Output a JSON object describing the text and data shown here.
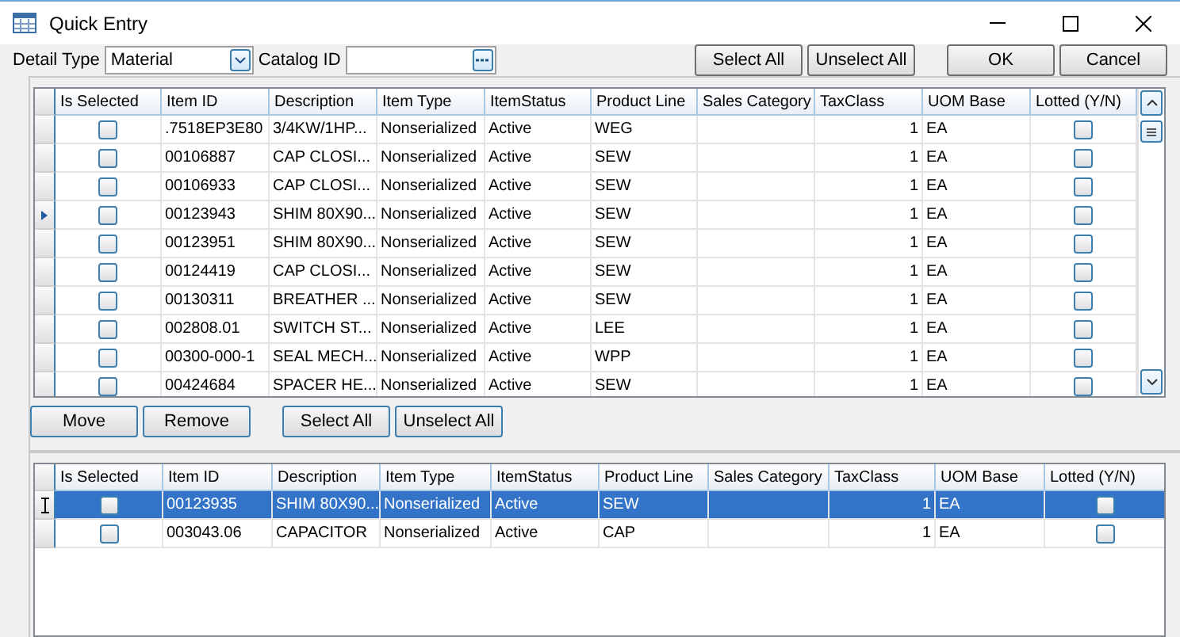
{
  "window": {
    "title": "Quick Entry"
  },
  "toolbar": {
    "detail_type_label": "Detail Type",
    "detail_type_value": "Material",
    "catalog_label": "Catalog ID",
    "buttons": [
      "Select All",
      "Unselect All",
      "OK",
      "Cancel"
    ]
  },
  "top_grid": {
    "columns": [
      {
        "label": "Is Selected",
        "kind": "check"
      },
      {
        "label": "Item ID",
        "kind": "text"
      },
      {
        "label": "Description",
        "kind": "text"
      },
      {
        "label": "Item Type",
        "kind": "text"
      },
      {
        "label": "ItemStatus",
        "kind": "text"
      },
      {
        "label": "Product Line",
        "kind": "text"
      },
      {
        "label": "Sales Category",
        "kind": "text"
      },
      {
        "label": "TaxClass",
        "kind": "number"
      },
      {
        "label": "UOM Base",
        "kind": "text"
      },
      {
        "label": "Lotted (Y/N)",
        "kind": "check"
      }
    ],
    "rows": [
      {
        "current": false,
        "selected": false,
        "cells": [
          false,
          ".7518EP3E80",
          "3/4KW/1HP...",
          "Nonserialized",
          "Active",
          "WEG",
          null,
          "1",
          "EA",
          false
        ]
      },
      {
        "current": false,
        "selected": false,
        "cells": [
          false,
          "00106887",
          "CAP CLOSI...",
          "Nonserialized",
          "Active",
          "SEW",
          null,
          "1",
          "EA",
          false
        ]
      },
      {
        "current": false,
        "selected": false,
        "cells": [
          false,
          "00106933",
          "CAP CLOSI...",
          "Nonserialized",
          "Active",
          "SEW",
          null,
          "1",
          "EA",
          false
        ]
      },
      {
        "current": true,
        "selected": false,
        "cells": [
          false,
          "00123943",
          "SHIM 80X90...",
          "Nonserialized",
          "Active",
          "SEW",
          null,
          "1",
          "EA",
          false
        ]
      },
      {
        "current": false,
        "selected": false,
        "cells": [
          false,
          "00123951",
          "SHIM 80X90...",
          "Nonserialized",
          "Active",
          "SEW",
          null,
          "1",
          "EA",
          false
        ]
      },
      {
        "current": false,
        "selected": false,
        "cells": [
          false,
          "00124419",
          "CAP CLOSI...",
          "Nonserialized",
          "Active",
          "SEW",
          null,
          "1",
          "EA",
          false
        ]
      },
      {
        "current": false,
        "selected": false,
        "cells": [
          false,
          "00130311",
          "BREATHER ...",
          "Nonserialized",
          "Active",
          "SEW",
          null,
          "1",
          "EA",
          false
        ]
      },
      {
        "current": false,
        "selected": false,
        "cells": [
          false,
          "002808.01",
          "SWITCH ST...",
          "Nonserialized",
          "Active",
          "LEE",
          null,
          "1",
          "EA",
          false
        ]
      },
      {
        "current": false,
        "selected": false,
        "cells": [
          false,
          "00300-000-1",
          "SEAL MECH...",
          "Nonserialized",
          "Active",
          "WPP",
          null,
          "1",
          "EA",
          false
        ]
      },
      {
        "current": false,
        "selected": false,
        "cells": [
          false,
          "00424684",
          "SPACER HE...",
          "Nonserialized",
          "Active",
          "SEW",
          null,
          "1",
          "EA",
          false
        ]
      }
    ]
  },
  "grid_buttons": [
    "Move",
    "Remove",
    "Select All",
    "Unselect All"
  ],
  "bottom_grid": {
    "columns": [
      {
        "label": "Is Selected",
        "kind": "check"
      },
      {
        "label": "Item ID",
        "kind": "text"
      },
      {
        "label": "Description",
        "kind": "text"
      },
      {
        "label": "Item Type",
        "kind": "text"
      },
      {
        "label": "ItemStatus",
        "kind": "text"
      },
      {
        "label": "Product Line",
        "kind": "text"
      },
      {
        "label": "Sales Category",
        "kind": "text"
      },
      {
        "label": "TaxClass",
        "kind": "number"
      },
      {
        "label": "UOM Base",
        "kind": "text"
      },
      {
        "label": "Lotted (Y/N)",
        "kind": "check"
      }
    ],
    "rows": [
      {
        "current": true,
        "selected": true,
        "cells": [
          false,
          "00123935",
          "SHIM 80X90...",
          "Nonserialized",
          "Active",
          "SEW",
          null,
          "1",
          "EA",
          false
        ]
      },
      {
        "current": false,
        "selected": false,
        "cells": [
          false,
          "003043.06",
          "CAPACITOR",
          "Nonserialized",
          "Active",
          "CAP",
          null,
          "1",
          "EA",
          false
        ]
      }
    ]
  }
}
